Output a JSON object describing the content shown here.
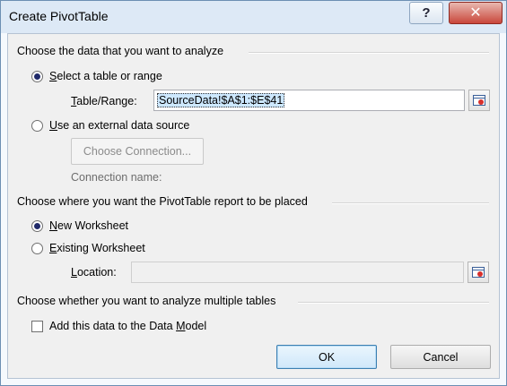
{
  "window": {
    "title": "Create PivotTable",
    "help_glyph": "?",
    "close_glyph": "✕"
  },
  "analyze_section": {
    "heading": "Choose the data that you want to analyze",
    "select_range": {
      "accel": "S",
      "rest": "elect a table or range",
      "selected": true
    },
    "table_range_label": {
      "accel": "T",
      "rest": "able/Range:"
    },
    "table_range_value": "SourceData!$A$1:$E$41",
    "external": {
      "accel": "U",
      "rest": "se an external data source",
      "selected": false
    },
    "choose_connection": "Choose Connection...",
    "connection_name_label": "Connection name:"
  },
  "placement_section": {
    "heading": "Choose where you want the PivotTable report to be placed",
    "new_worksheet": {
      "accel": "N",
      "rest": "ew Worksheet",
      "selected": true
    },
    "existing_worksheet": {
      "accel": "E",
      "rest": "xisting Worksheet",
      "selected": false
    },
    "location_label": {
      "accel": "L",
      "rest": "ocation:"
    },
    "location_value": ""
  },
  "multiple_section": {
    "heading": "Choose whether you want to analyze multiple tables",
    "data_model_checkbox": {
      "pre": "Add this data to the Data ",
      "accel": "M",
      "post": "odel",
      "checked": false
    }
  },
  "buttons": {
    "ok": "OK",
    "cancel": "Cancel"
  },
  "icons": {
    "help": "help-icon",
    "close": "close-icon",
    "range_picker": "range-picker-icon"
  }
}
